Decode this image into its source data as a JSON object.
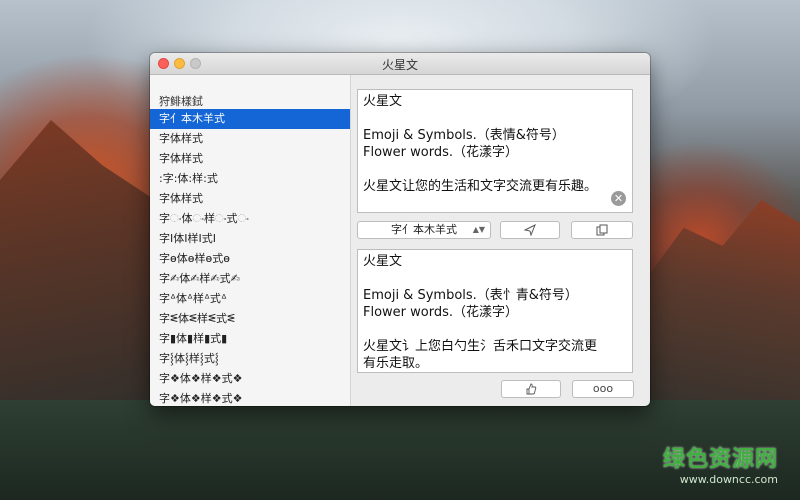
{
  "window": {
    "title": "火星文"
  },
  "sidebar": {
    "header": "狩鲱樣鉽",
    "items": [
      "字亻本木羊式",
      "字体样式",
      "字体样式",
      ":字:体:样:式",
      "字体样式",
      "字ං体ං样ං式ං",
      "字ⵏ体ⵏ样ⵏ式ⵏ",
      "字ɵ体ɵ样ɵ式ɵ",
      "字✍体✍样✍式✍",
      "字ᐞ体ᐞ样ᐞ式ᐞ",
      "字ᓬ体ᓬ样ᓬ式ᓬ",
      "字▮体▮样▮式▮",
      "字⸾体⸾样⸾式⸾",
      "字❖体❖样❖式❖",
      "字❖体❖样❖式❖"
    ],
    "selected_index": 0
  },
  "input": {
    "lines": [
      "火星文",
      "",
      "Emoji & Symbols.（表情&符号）",
      "Flower words.（花漾字）",
      "",
      "火星文让您的生活和文字交流更有乐趣。"
    ],
    "clear_icon": "clear-circle-icon"
  },
  "toolbar": {
    "style_select_value": "字亻本木羊式",
    "send_icon": "send-icon",
    "copy_icon": "copy-icon"
  },
  "output": {
    "lines": [
      "火星文",
      "",
      "Emoji & Symbols.（表忄青&符号）",
      "Flower words.（花漾字）",
      "",
      "火星文讠上您白勺生氵舌禾口文字交流更",
      "有乐走取。"
    ]
  },
  "footer": {
    "like_icon": "thumbs-up-icon",
    "more_label": "ooo"
  },
  "watermark": {
    "title": "绿色资源网",
    "url": "www.downcc.com"
  }
}
